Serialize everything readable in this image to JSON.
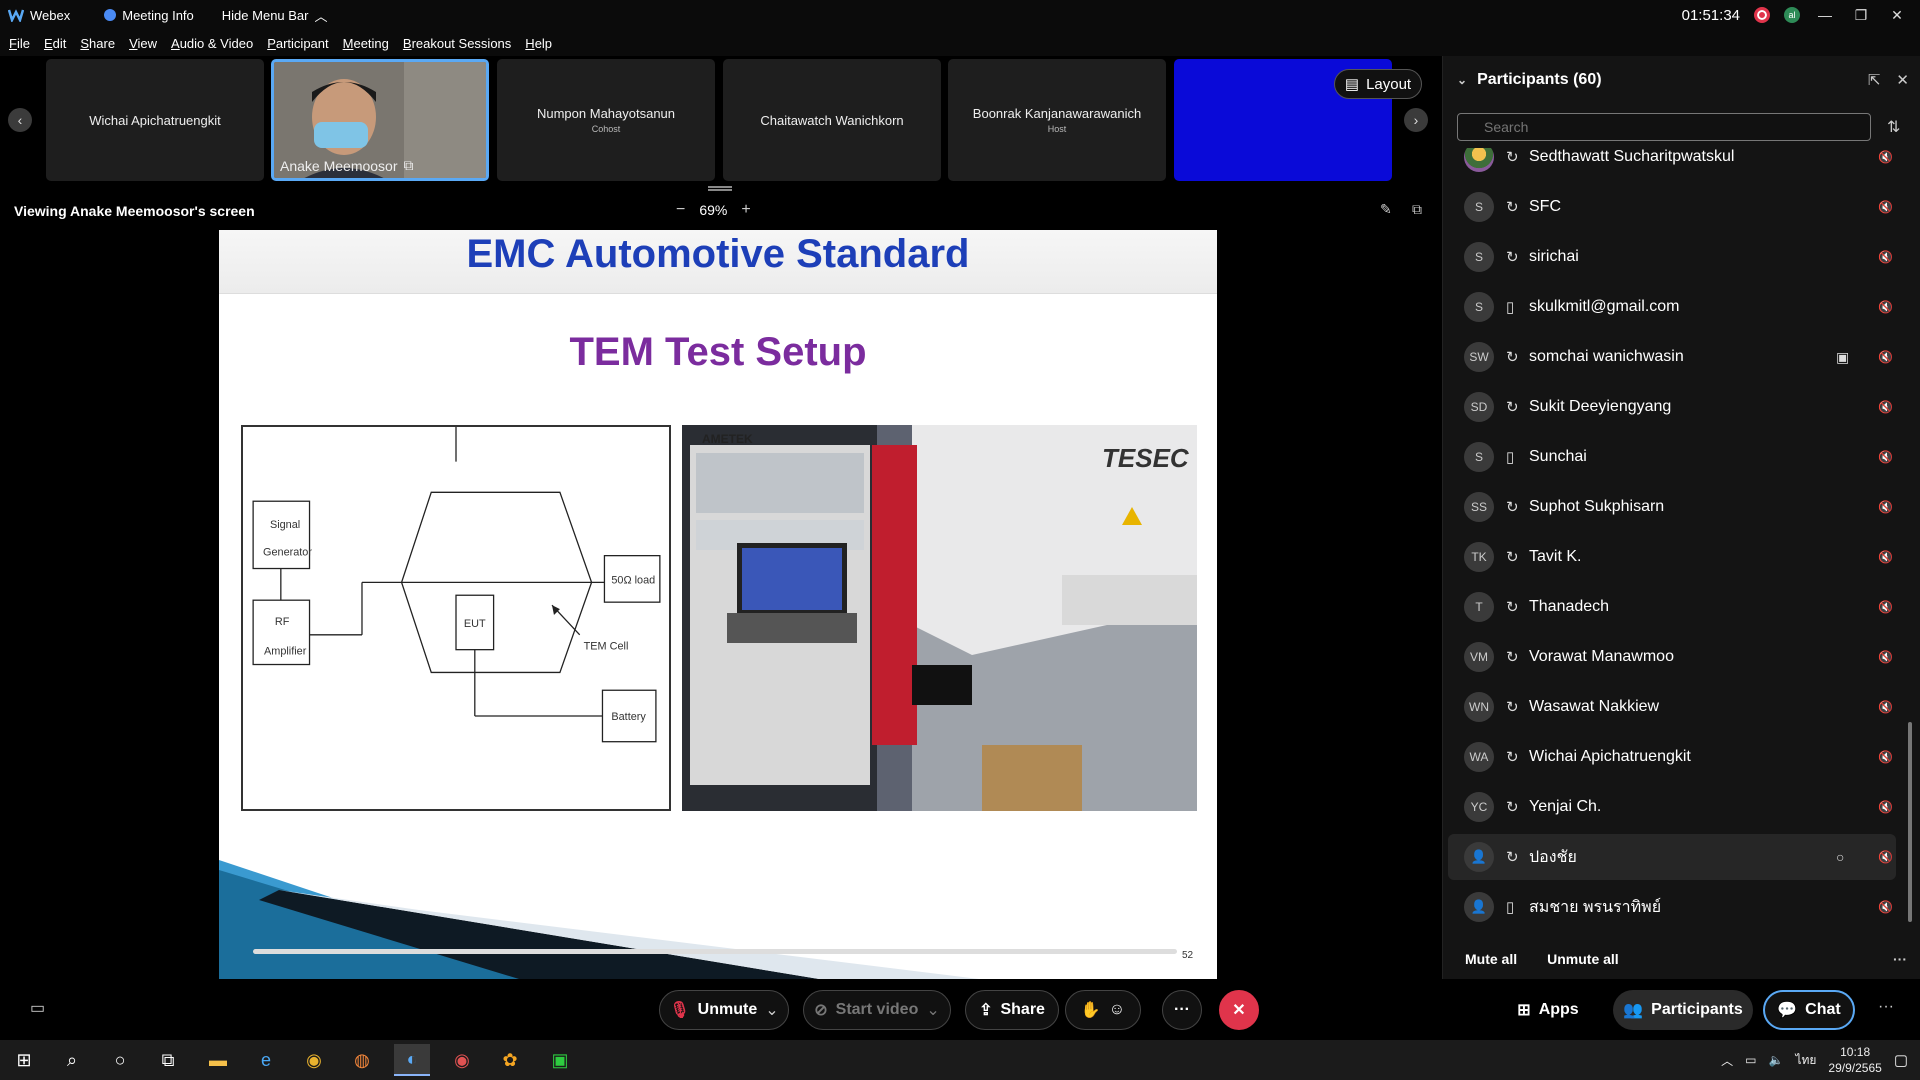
{
  "titlebar": {
    "app": "Webex",
    "meeting_info": "Meeting Info",
    "hide_menu": "Hide Menu Bar",
    "time": "01:51:34"
  },
  "menu": [
    "File",
    "Edit",
    "Share",
    "View",
    "Audio & Video",
    "Participant",
    "Meeting",
    "Breakout Sessions",
    "Help"
  ],
  "strip": {
    "tiles": [
      {
        "name": "Wichai Apichatruengkit",
        "role": ""
      },
      {
        "name": "Anake Meemoosor",
        "role": ""
      },
      {
        "name": "Numpon Mahayotsanun",
        "role": "Cohost"
      },
      {
        "name": "Chaitawatch Wanichkorn",
        "role": ""
      },
      {
        "name": "Boonrak Kanjanawarawanich",
        "role": "Host"
      }
    ],
    "layout_label": "Layout"
  },
  "viewbar": {
    "title": "Viewing Anake Meemoosor's screen",
    "zoom": "69%"
  },
  "slide": {
    "header": "EMC  Automotive Standard",
    "subtitle": "TEM Test Setup",
    "diagram": {
      "signal_generator_1": "Signal",
      "signal_generator_2": "Generator",
      "rf_1": "RF",
      "rf_2": "Amplifier",
      "eut": "EUT",
      "load": "50Ω load",
      "tem_cell": "TEM Cell",
      "battery": "Battery"
    },
    "photo": {
      "ametek": "AMETEK",
      "tesec": "TESEC"
    },
    "page": "52"
  },
  "panel": {
    "title": "Participants (60)",
    "search_placeholder": "Search",
    "participants": [
      {
        "initials": "",
        "name": "Sedthawatt Sucharitpwatskul",
        "device": "sync",
        "extra": ""
      },
      {
        "initials": "S",
        "name": "SFC",
        "device": "sync",
        "extra": ""
      },
      {
        "initials": "S",
        "name": "sirichai",
        "device": "sync",
        "extra": ""
      },
      {
        "initials": "S",
        "name": "skulkmitl@gmail.com",
        "device": "phone",
        "extra": ""
      },
      {
        "initials": "SW",
        "name": "somchai wanichwasin",
        "device": "sync",
        "extra": "video"
      },
      {
        "initials": "SD",
        "name": "Sukit Deeyiengyang",
        "device": "sync",
        "extra": ""
      },
      {
        "initials": "S",
        "name": "Sunchai",
        "device": "phone",
        "extra": ""
      },
      {
        "initials": "SS",
        "name": "Suphot Sukphisarn",
        "device": "sync",
        "extra": ""
      },
      {
        "initials": "TK",
        "name": "Tavit K.",
        "device": "sync",
        "extra": ""
      },
      {
        "initials": "T",
        "name": "Thanadech",
        "device": "sync",
        "extra": ""
      },
      {
        "initials": "VM",
        "name": "Vorawat Manawmoo",
        "device": "sync",
        "extra": ""
      },
      {
        "initials": "WN",
        "name": "Wasawat Nakkiew",
        "device": "sync",
        "extra": ""
      },
      {
        "initials": "WA",
        "name": "Wichai Apichatruengkit",
        "device": "sync",
        "extra": ""
      },
      {
        "initials": "YC",
        "name": "Yenjai Ch.",
        "device": "sync",
        "extra": ""
      },
      {
        "initials": "",
        "name": "ปองชัย",
        "device": "sync",
        "extra": "chat"
      },
      {
        "initials": "",
        "name": "สมชาย พรนราทิพย์",
        "device": "phone",
        "extra": ""
      }
    ],
    "mute_all": "Mute all",
    "unmute_all": "Unmute all"
  },
  "controls": {
    "unmute": "Unmute",
    "start_video": "Start video",
    "share": "Share",
    "apps": "Apps",
    "participants": "Participants",
    "chat": "Chat"
  },
  "taskbar": {
    "lang": "ไทย",
    "time": "10:18",
    "date": "29/9/2565"
  },
  "colors": {
    "accent": "#5aa9f5",
    "end_red": "#e0344b",
    "slide_title": "#1d3fb8",
    "slide_subtitle": "#7b2c9e"
  }
}
